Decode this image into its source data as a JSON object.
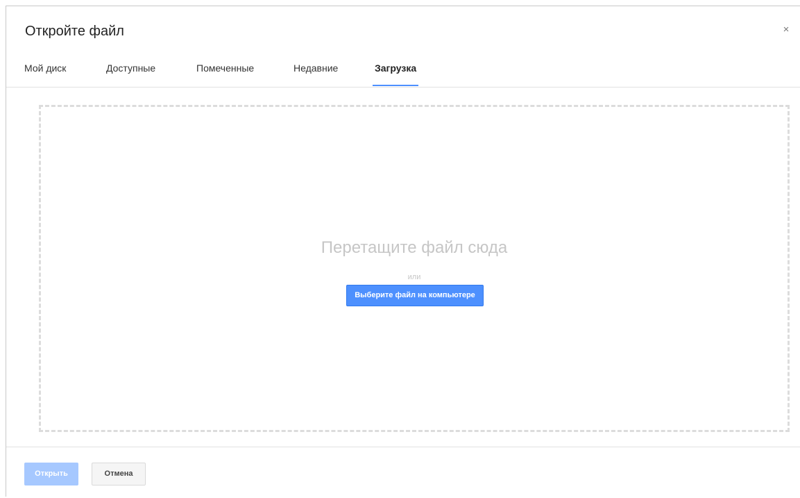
{
  "dialog": {
    "title": "Откройте файл",
    "close_icon": "×"
  },
  "tabs": [
    {
      "label": "Мой диск",
      "active": false
    },
    {
      "label": "Доступные",
      "active": false
    },
    {
      "label": "Помеченные",
      "active": false
    },
    {
      "label": "Недавние",
      "active": false
    },
    {
      "label": "Загрузка",
      "active": true
    }
  ],
  "upload": {
    "drop_text": "Перетащите файл сюда",
    "or_text": "или",
    "select_button": "Выберите файл на компьютере"
  },
  "footer": {
    "open_label": "Открыть",
    "cancel_label": "Отмена"
  },
  "colors": {
    "accent": "#4d90fe",
    "disabled_accent": "#a6c8ff"
  }
}
